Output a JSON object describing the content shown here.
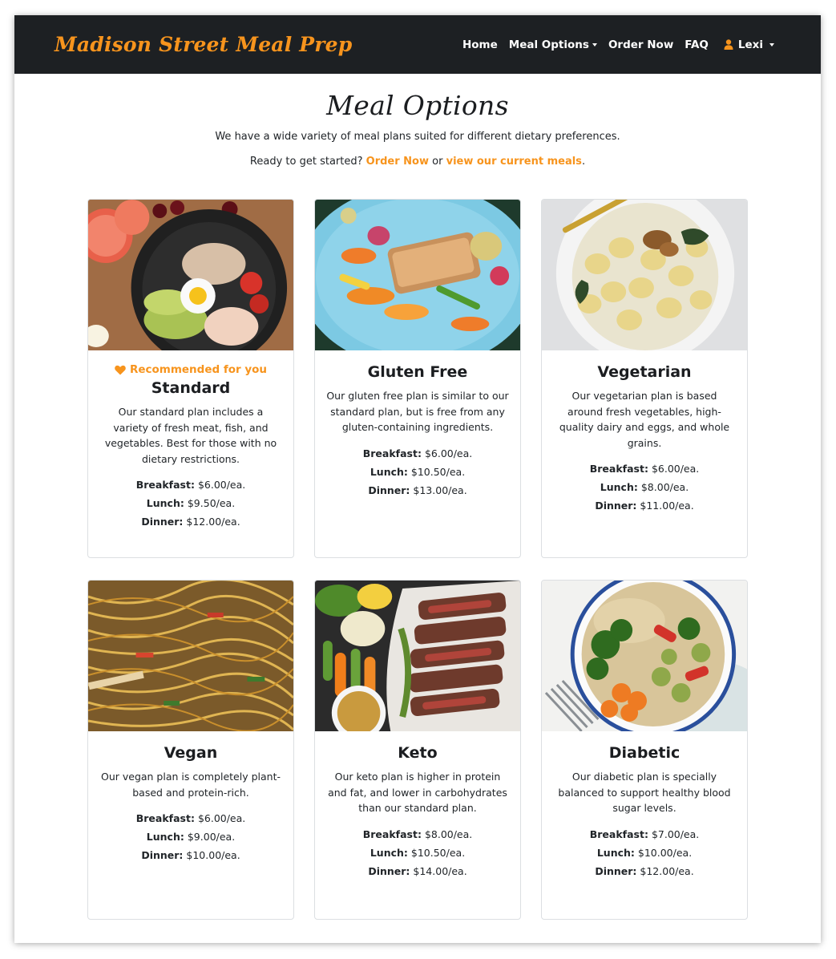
{
  "brand": "Madison Street Meal Prep",
  "nav": {
    "home": "Home",
    "meal_options": "Meal Options",
    "order_now": "Order Now",
    "faq": "FAQ",
    "user": "Lexi"
  },
  "header": {
    "title": "Meal Options",
    "subtitle": "We have a wide variety of meal plans suited for different dietary preferences.",
    "cta_prefix": "Ready to get started?",
    "cta_order": "Order Now",
    "cta_or": "or",
    "cta_view": "view our current meals",
    "cta_suffix": "."
  },
  "price_labels": {
    "breakfast": "Breakfast:",
    "lunch": "Lunch:",
    "dinner": "Dinner:"
  },
  "cards": [
    {
      "badge": "Recommended for you",
      "title": "Standard",
      "text": "Our standard plan includes a variety of fresh meat, fish, and vegetables. Best for those with no dietary restrictions.",
      "breakfast": "$6.00/ea.",
      "lunch": "$9.50/ea.",
      "dinner": "$12.00/ea."
    },
    {
      "title": "Gluten Free",
      "text": "Our gluten free plan is similar to our standard plan, but is free from any gluten-containing ingredients.",
      "breakfast": "$6.00/ea.",
      "lunch": "$10.50/ea.",
      "dinner": "$13.00/ea."
    },
    {
      "title": "Vegetarian",
      "text": "Our vegetarian plan is based around fresh vegetables, high-quality dairy and eggs, and whole grains.",
      "breakfast": "$6.00/ea.",
      "lunch": "$8.00/ea.",
      "dinner": "$11.00/ea."
    },
    {
      "title": "Vegan",
      "text": "Our vegan plan is completely plant-based and protein-rich.",
      "breakfast": "$6.00/ea.",
      "lunch": "$9.00/ea.",
      "dinner": "$10.00/ea."
    },
    {
      "title": "Keto",
      "text": "Our keto plan is higher in protein and fat, and lower in carbohydrates than our standard plan.",
      "breakfast": "$8.00/ea.",
      "lunch": "$10.50/ea.",
      "dinner": "$14.00/ea."
    },
    {
      "title": "Diabetic",
      "text": "Our diabetic plan is specially balanced to support healthy blood sugar levels.",
      "breakfast": "$7.00/ea.",
      "lunch": "$10.00/ea.",
      "dinner": "$12.00/ea."
    }
  ],
  "colors": {
    "accent": "#f7941d",
    "navbar": "#1d2023"
  }
}
